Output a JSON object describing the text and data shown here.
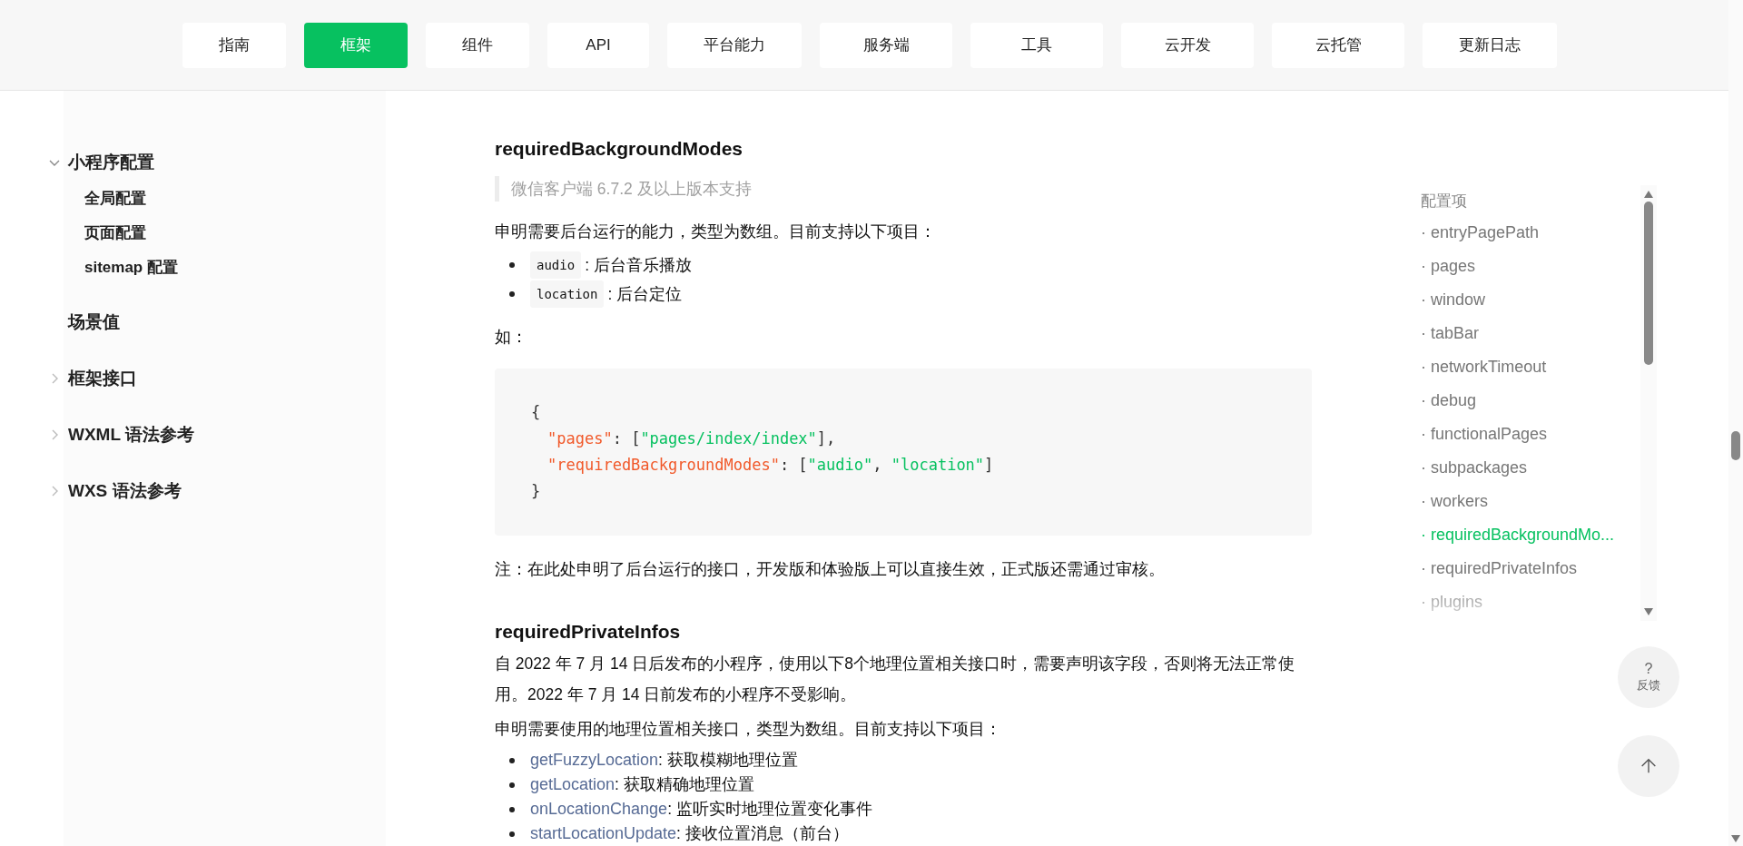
{
  "nav": {
    "tabs": [
      {
        "label": "指南",
        "selected": false
      },
      {
        "label": "框架",
        "selected": true
      },
      {
        "label": "组件",
        "selected": false
      },
      {
        "label": "API",
        "selected": false
      },
      {
        "label": "平台能力",
        "selected": false
      },
      {
        "label": "服务端",
        "selected": false
      },
      {
        "label": "工具",
        "selected": false
      },
      {
        "label": "云开发",
        "selected": false
      },
      {
        "label": "云托管",
        "selected": false
      },
      {
        "label": "更新日志",
        "selected": false
      }
    ]
  },
  "sidebar": {
    "items": [
      {
        "label": "小程序配置",
        "kind": "folder",
        "expanded": true,
        "children": [
          {
            "label": "全局配置"
          },
          {
            "label": "页面配置"
          },
          {
            "label": "sitemap 配置"
          }
        ]
      },
      {
        "label": "场景值",
        "kind": "page"
      },
      {
        "label": "框架接口",
        "kind": "folder",
        "expanded": false
      },
      {
        "label": "WXML 语法参考",
        "kind": "folder",
        "expanded": false
      },
      {
        "label": "WXS 语法参考",
        "kind": "folder",
        "expanded": false
      }
    ]
  },
  "content": [
    {
      "kind": "heading",
      "text": "requiredBackgroundModes"
    },
    {
      "kind": "note",
      "text": "微信客户端 6.7.2 及以上版本支持"
    },
    {
      "kind": "paragraph",
      "text": "申明需要后台运行的能力，类型为数组。目前支持以下项目："
    },
    {
      "kind": "list",
      "items": [
        {
          "kind": "code",
          "term": "audio",
          "text": ": 后台音乐播放"
        },
        {
          "kind": "code",
          "term": "location",
          "text": ": 后台定位"
        }
      ]
    },
    {
      "kind": "paragraph",
      "text": "如："
    },
    {
      "kind": "code",
      "lines": [
        {
          "indented": false,
          "tokens": [
            {
              "kind": "punct",
              "s": "{"
            }
          ]
        },
        {
          "indented": true,
          "tokens": [
            {
              "kind": "key",
              "s": "\"pages\""
            },
            {
              "kind": "punct",
              "s": ": ["
            },
            {
              "kind": "string",
              "s": "\"pages/index/index\""
            },
            {
              "kind": "punct",
              "s": "],"
            }
          ]
        },
        {
          "indented": true,
          "tokens": [
            {
              "kind": "key",
              "s": "\"requiredBackgroundModes\""
            },
            {
              "kind": "punct",
              "s": ": ["
            },
            {
              "kind": "string",
              "s": "\"audio\""
            },
            {
              "kind": "punct",
              "s": ", "
            },
            {
              "kind": "string",
              "s": "\"location\""
            },
            {
              "kind": "punct",
              "s": "]"
            }
          ]
        },
        {
          "indented": false,
          "tokens": [
            {
              "kind": "punct",
              "s": "}"
            }
          ]
        }
      ]
    },
    {
      "kind": "paragraph",
      "text": "注：在此处申明了后台运行的接口，开发版和体验版上可以直接生效，正式版还需通过审核。"
    },
    {
      "kind": "heading",
      "text": "requiredPrivateInfos"
    },
    {
      "kind": "paragraph",
      "text": "自 2022 年 7 月 14 日后发布的小程序，使用以下8个地理位置相关接口时，需要声明该字段，否则将无法正常使用。2022 年 7 月 14 日前发布的小程序不受影响。"
    },
    {
      "kind": "paragraph",
      "text": "申明需要使用的地理位置相关接口，类型为数组。目前支持以下项目："
    },
    {
      "kind": "list",
      "items": [
        {
          "kind": "link",
          "term": "getFuzzyLocation",
          "text": ": 获取模糊地理位置"
        },
        {
          "kind": "link",
          "term": "getLocation",
          "text": ": 获取精确地理位置"
        },
        {
          "kind": "link",
          "term": "onLocationChange",
          "text": ": 监听实时地理位置变化事件"
        },
        {
          "kind": "link",
          "term": "startLocationUpdate",
          "text": ": 接收位置消息（前台）"
        }
      ]
    }
  ],
  "toc": {
    "title": "配置项",
    "items": [
      {
        "label": "· entryPagePath",
        "selected": false
      },
      {
        "label": "· pages",
        "selected": false
      },
      {
        "label": "· window",
        "selected": false
      },
      {
        "label": "· tabBar",
        "selected": false
      },
      {
        "label": "· networkTimeout",
        "selected": false
      },
      {
        "label": "· debug",
        "selected": false
      },
      {
        "label": "· functionalPages",
        "selected": false
      },
      {
        "label": "· subpackages",
        "selected": false
      },
      {
        "label": "· workers",
        "selected": false
      },
      {
        "label": "· requiredBackgroundMo...",
        "selected": true
      },
      {
        "label": "· requiredPrivateInfos",
        "selected": false
      },
      {
        "label": "· plugins",
        "selected": false
      }
    ]
  },
  "floating": {
    "help_mark": "?",
    "feedback": "反馈"
  }
}
